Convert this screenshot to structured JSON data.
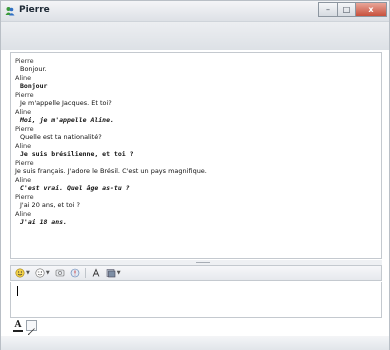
{
  "window": {
    "title": "Pierre",
    "controls": {
      "minimize": "–",
      "maximize": "□",
      "close": "x"
    }
  },
  "conversation": [
    {
      "sender": "Pierre",
      "text": "Bonjour.",
      "style": "pierre"
    },
    {
      "sender": "Aline",
      "text": "Bonjour",
      "style": "aline"
    },
    {
      "sender": "Pierre",
      "text": "Je m'appelle Jacques. Et toi?",
      "style": "pierre"
    },
    {
      "sender": "Aline",
      "text": "Moi, je m'appelle Aline.",
      "style": "aline-italic"
    },
    {
      "sender": "Pierre",
      "text": "Quelle est ta nationalité?",
      "style": "pierre"
    },
    {
      "sender": "Aline",
      "text": "Je suis brésilienne, et toi ?",
      "style": "aline"
    },
    {
      "sender": "Pierre",
      "text": "Je suis français. J'adore le Brésil. C'est un  pays magnifique.",
      "style": "pierre-noindent"
    },
    {
      "sender": "Aline",
      "text": "C'est vrai. Quel âge as-tu ?",
      "style": "aline-italic"
    },
    {
      "sender": "Pierre",
      "text": "J'ai 20 ans, et toi ?",
      "style": "pierre"
    },
    {
      "sender": "Aline",
      "text": "J'ai 18 ans.",
      "style": "aline-italic"
    }
  ],
  "toolbar": {
    "items": [
      "emoticon-icon",
      "wink-icon",
      "voice-clip-icon",
      "nudge-icon",
      "font-icon",
      "background-icon"
    ]
  },
  "format": {
    "font_label": "A"
  }
}
